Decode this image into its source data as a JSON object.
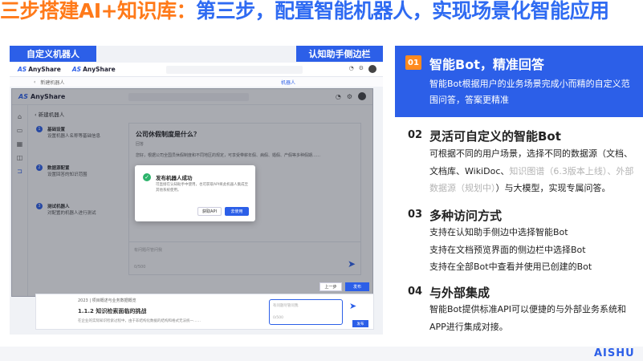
{
  "title": {
    "prefix": "三步搭建AI+知识库：",
    "main": "第三步，配置智能机器人，实现场景化智能应用"
  },
  "tags": {
    "left": "自定义机器人",
    "right": "认知助手侧边栏"
  },
  "app": {
    "logo": "AnyShare",
    "back_tab": "新建机器人",
    "back_robot_label": "机器人",
    "crumb": "新建机器人",
    "steps": [
      {
        "num": "1",
        "title": "基础设置",
        "desc": "设置机器人名称等基础信息"
      },
      {
        "num": "2",
        "title": "数据源配置",
        "desc": "设置回答的知识范围"
      },
      {
        "num": "3",
        "title": "测试机器人",
        "desc": "对配置的机器人进行测试"
      }
    ],
    "chat": {
      "question": "公司休假制度是什么？",
      "answer_label": "回答",
      "answer_line": "您好，根据公司全国员休假制度和不同地区的规定，可享受带薪年假、病假、婚假、产假等多种假期……"
    },
    "input_placeholder": "有问题尽管问我",
    "input_count": "0/500",
    "modal": {
      "title": "发布机器人成功",
      "desc": "可直接在认知助手中使用，也可获取API将此机器人集成至其他系统使用。",
      "btn_api": "获取API",
      "btn_done": "去使用"
    },
    "prev_label": "上一步",
    "publish_label": "发布",
    "doc": {
      "line1": "2023 | 项目概述与业务数据概览",
      "heading": "1.1.2 知识检索面临的挑战",
      "line2": "在企业的实际知识检索过程中，由于非结构化数据的结构和格式无法统一……",
      "chat_ph": "有问题尽管问我",
      "chat_ph2": "0/500",
      "btn": "发布"
    }
  },
  "feature_highlight": {
    "num": "01",
    "title": "智能Bot，精准回答",
    "desc": "智能Bot根据用户的业务场景完成小而精的自定义范围问答，答案更精准"
  },
  "features": [
    {
      "num": "02",
      "title": "灵活可自定义的智能Bot",
      "desc_a": "可根据不同的用户场景，选择不同的数据源（文档、文档库、WikiDoc、",
      "desc_gray": "知识图谱（6.3版本上线）、外部数据源（规划中）",
      "desc_b": "）与大模型，实现专属问答。"
    },
    {
      "num": "03",
      "title": "多种访问方式",
      "lines": [
        "支持在认知助手侧边中选择智能Bot",
        "支持在文档预览界面的侧边栏中选择Bot",
        "支持在全部Bot中查看并使用已创建的Bot"
      ]
    },
    {
      "num": "04",
      "title": "与外部集成",
      "desc": "智能Bot提供标准API可以便捷的与外部业务系统和APP进行集成对接。"
    }
  ],
  "corner_logo": "AISHU爱"
}
